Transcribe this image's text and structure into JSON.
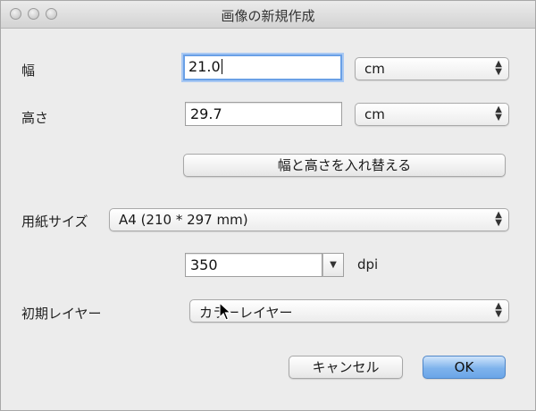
{
  "window": {
    "title": "画像の新規作成"
  },
  "width": {
    "label": "幅",
    "value": "21.0",
    "unit": "cm"
  },
  "height": {
    "label": "高さ",
    "value": "29.7",
    "unit": "cm"
  },
  "swap_button": {
    "label": "幅と高さを入れ替える"
  },
  "paper_size": {
    "label": "用紙サイズ",
    "value": "A4 (210 * 297 mm)"
  },
  "resolution": {
    "value": "350",
    "unit": "dpi"
  },
  "initial_layer": {
    "label": "初期レイヤー",
    "value": "カラーレイヤー"
  },
  "buttons": {
    "cancel": "キャンセル",
    "ok": "OK"
  },
  "icons": {
    "popup_arrows": "up-down-chevron-icon",
    "dropdown": "chevron-down-icon",
    "pointer": "mouse-pointer-icon"
  }
}
